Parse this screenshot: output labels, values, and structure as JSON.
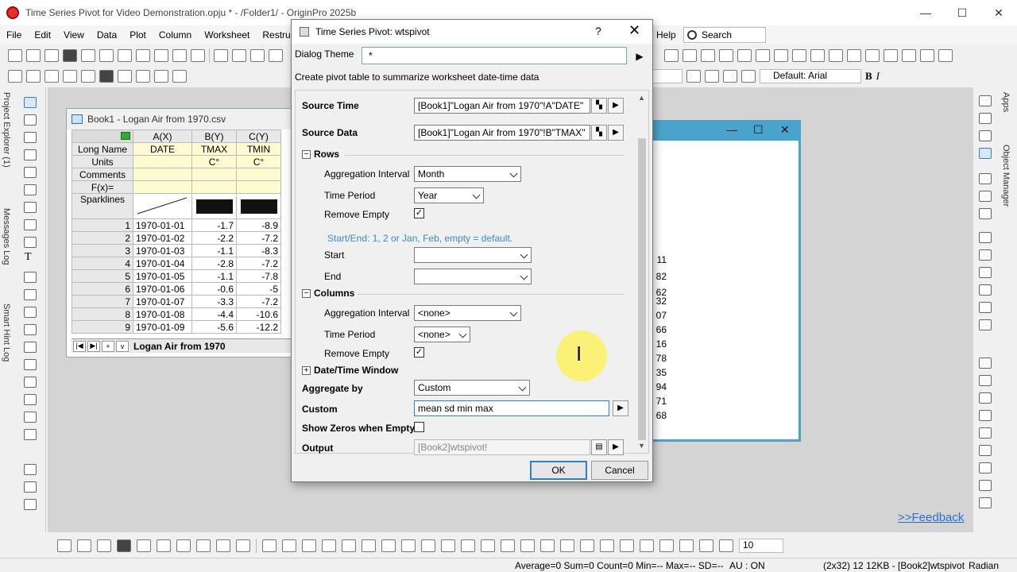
{
  "window": {
    "title": "Time Series Pivot for Video Demonstration.opju * - /Folder1/ - OriginPro 2025b",
    "minimize": "—",
    "maximize": "☐",
    "close": "✕"
  },
  "menu": [
    {
      "label": "File"
    },
    {
      "label": "Edit"
    },
    {
      "label": "View"
    },
    {
      "label": "Data"
    },
    {
      "label": "Plot"
    },
    {
      "label": "Column"
    },
    {
      "label": "Worksheet"
    },
    {
      "label": "Restruct"
    }
  ],
  "menu_right": {
    "help": "Help",
    "search_placeholder": "Search"
  },
  "left_tabs": [
    "Project Explorer (1)",
    "Messages Log",
    "Smart Hint Log"
  ],
  "right_tabs": [
    "Apps",
    "Object Manager"
  ],
  "font_combo": "Default: Arial",
  "size_combo": "0",
  "book1": {
    "title": "Book1 - Logan Air from 1970.csv",
    "columns": [
      "A(X)",
      "B(Y)",
      "C(Y)"
    ],
    "meta": {
      "long_name_label": "Long Name",
      "units_label": "Units",
      "comments_label": "Comments",
      "fx_label": "F(x)=",
      "sparklines_label": "Sparklines",
      "long_names": [
        "DATE",
        "TMAX",
        "TMIN"
      ],
      "units": [
        "",
        "C°",
        "C°"
      ]
    },
    "rows": [
      {
        "n": "1",
        "date": "1970-01-01",
        "tmax": "-1.7",
        "tmin": "-8.9"
      },
      {
        "n": "2",
        "date": "1970-01-02",
        "tmax": "-2.2",
        "tmin": "-7.2"
      },
      {
        "n": "3",
        "date": "1970-01-03",
        "tmax": "-1.1",
        "tmin": "-8.3"
      },
      {
        "n": "4",
        "date": "1970-01-04",
        "tmax": "-2.8",
        "tmin": "-7.2"
      },
      {
        "n": "5",
        "date": "1970-01-05",
        "tmax": "-1.1",
        "tmin": "-7.8"
      },
      {
        "n": "6",
        "date": "1970-01-06",
        "tmax": "-0.6",
        "tmin": "-5"
      },
      {
        "n": "7",
        "date": "1970-01-07",
        "tmax": "-3.3",
        "tmin": "-7.2"
      },
      {
        "n": "8",
        "date": "1970-01-08",
        "tmax": "-4.4",
        "tmin": "-10.6"
      },
      {
        "n": "9",
        "date": "1970-01-09",
        "tmax": "-5.6",
        "tmin": "-12.2"
      }
    ],
    "sheet_tab": "Logan Air from 1970"
  },
  "book2": {
    "values": [
      "11",
      "82",
      "62",
      "32",
      "07",
      "66",
      "16",
      "78",
      "35",
      "94",
      "71",
      "68"
    ]
  },
  "dialog": {
    "title": "Time Series Pivot: wtspivot",
    "help": "?",
    "close": "✕",
    "theme_label": "Dialog Theme",
    "theme_value": "*",
    "description": "Create pivot table to summarize worksheet date-time data",
    "source_time_label": "Source Time",
    "source_time_value": "[Book1]\"Logan Air from 1970\"!A\"DATE\"",
    "source_data_label": "Source Data",
    "source_data_value": "[Book1]\"Logan Air from 1970\"!B\"TMAX\"",
    "rows_section": "Rows",
    "rows_agg_label": "Aggregation Interval",
    "rows_agg_value": "Month",
    "rows_period_label": "Time Period",
    "rows_period_value": "Year",
    "rows_remove_label": "Remove Empty",
    "rows_hint": "Start/End: 1, 2 or Jan, Feb, empty = default.",
    "start_label": "Start",
    "end_label": "End",
    "columns_section": "Columns",
    "cols_agg_label": "Aggregation Interval",
    "cols_agg_value": "<none>",
    "cols_period_label": "Time Period",
    "cols_period_value": "<none>",
    "cols_remove_label": "Remove Empty",
    "datetime_section": "Date/Time Window",
    "aggregate_label": "Aggregate by",
    "aggregate_value": "Custom",
    "custom_label": "Custom",
    "custom_value": "mean sd min max",
    "show_zeros_label": "Show Zeros when Empty",
    "output_label": "Output",
    "output_value": "[Book2]wtspivot!",
    "ok": "OK",
    "cancel": "Cancel",
    "check_mark": "✓"
  },
  "feedback": ">>Feedback",
  "status": {
    "stats": "Average=0 Sum=0 Count=0 Min=-- Max=-- SD=--",
    "au": "AU : ON",
    "cell": "(2x32) 12",
    "size": "12KB - [Book2]wtspivot",
    "angle": "Radian"
  }
}
